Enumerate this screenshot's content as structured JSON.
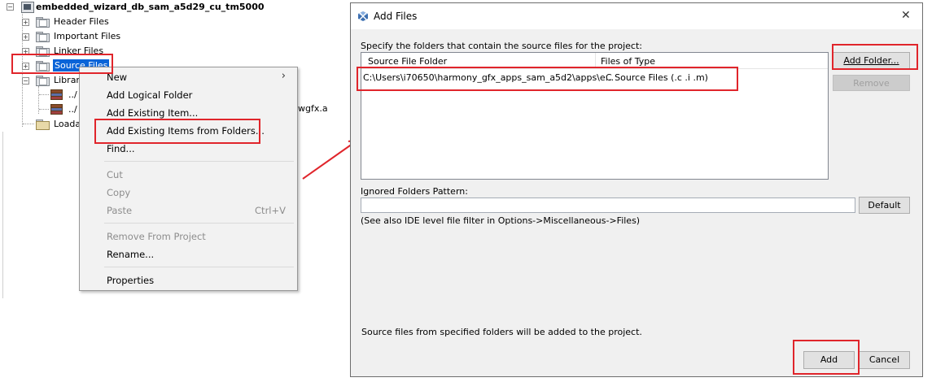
{
  "tree": {
    "project_name": "embedded_wizard_db_sam_a5d29_cu_tm5000",
    "items": [
      {
        "label": "Header Files"
      },
      {
        "label": "Important Files"
      },
      {
        "label": "Linker Files"
      },
      {
        "label": "Source Files"
      },
      {
        "label": "Librarie"
      },
      {
        "label": "../"
      },
      {
        "label": "../"
      },
      {
        "label": "Loada"
      }
    ],
    "lib_suffix": "wgfx.a",
    "expand_plus": "+",
    "expand_minus": "−"
  },
  "context_menu": {
    "items": [
      {
        "label": "New",
        "submenu_arrow": "›",
        "disabled": false
      },
      {
        "label": "Add Logical Folder",
        "disabled": false
      },
      {
        "label": "Add Existing Item...",
        "disabled": false
      },
      {
        "label": "Add Existing Items from Folders...",
        "disabled": false
      },
      {
        "label": "Find...",
        "disabled": false
      },
      {
        "label": "Cut",
        "disabled": true
      },
      {
        "label": "Copy",
        "disabled": true
      },
      {
        "label": "Paste",
        "shortcut": "Ctrl+V",
        "disabled": true
      },
      {
        "label": "Remove From Project",
        "disabled": true
      },
      {
        "label": "Rename...",
        "disabled": false
      },
      {
        "label": "Properties",
        "disabled": false
      }
    ]
  },
  "dialog": {
    "title": "Add Files",
    "close_glyph": "✕",
    "specify_label": "Specify the folders that contain the source files for the project:",
    "columns": [
      "Source File Folder",
      "Files of Type"
    ],
    "rows": [
      {
        "folder": "C:\\Users\\i70650\\harmony_gfx_apps_sam_a5d2\\apps\\e...",
        "type": "C Source Files (.c .i .m)"
      }
    ],
    "add_folder_label": "Add Folder...",
    "remove_label": "Remove",
    "ignored_label": "Ignored Folders Pattern:",
    "ignored_value": "",
    "default_label": "Default",
    "see_also": "(See also IDE level file filter in Options->Miscellaneous->Files)",
    "footer_note": "Source files from specified folders will be added to the project.",
    "add_label": "Add",
    "cancel_label": "Cancel"
  },
  "colors": {
    "highlight_red": "#e0252b",
    "selection_blue": "#0a64d8",
    "arrow_red": "#e0252b"
  }
}
